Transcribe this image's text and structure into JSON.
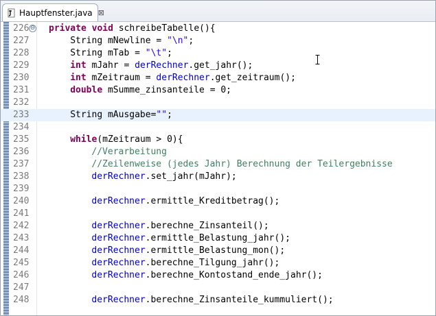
{
  "tab": {
    "title": "Hauptfenster.java",
    "close_glyph": "⊠",
    "icon": "java-file-icon"
  },
  "editor": {
    "current_line_index": 7,
    "lines": [
      {
        "num": "226",
        "fold": "⊖",
        "tokens": [
          {
            "t": "kw",
            "v": "private"
          },
          {
            "t": "p",
            "v": " "
          },
          {
            "t": "kw",
            "v": "void"
          },
          {
            "t": "p",
            "v": " schreibeTabelle(){"
          }
        ]
      },
      {
        "num": "227",
        "tokens": [
          {
            "t": "p",
            "v": "String mNewline = "
          },
          {
            "t": "str",
            "v": "\"\\n\""
          },
          {
            "t": "p",
            "v": ";"
          }
        ],
        "indent": 4
      },
      {
        "num": "228",
        "tokens": [
          {
            "t": "p",
            "v": "String mTab = "
          },
          {
            "t": "str",
            "v": "\"\\t\""
          },
          {
            "t": "p",
            "v": ";"
          }
        ],
        "indent": 4
      },
      {
        "num": "229",
        "tokens": [
          {
            "t": "kw",
            "v": "int"
          },
          {
            "t": "p",
            "v": " mJahr = "
          },
          {
            "t": "fld",
            "v": "derRechner"
          },
          {
            "t": "p",
            "v": ".get_jahr();"
          }
        ],
        "indent": 4
      },
      {
        "num": "230",
        "tokens": [
          {
            "t": "kw",
            "v": "int"
          },
          {
            "t": "p",
            "v": " mZeitraum = "
          },
          {
            "t": "fld",
            "v": "derRechner"
          },
          {
            "t": "p",
            "v": ".get_zeitraum();"
          }
        ],
        "indent": 4
      },
      {
        "num": "231",
        "tokens": [
          {
            "t": "kw",
            "v": "double"
          },
          {
            "t": "p",
            "v": " mSumme_zinsanteile = 0;"
          }
        ],
        "indent": 4
      },
      {
        "num": "232",
        "tokens": [],
        "indent": 0
      },
      {
        "num": "233",
        "tokens": [
          {
            "t": "p",
            "v": "String mAusgabe="
          },
          {
            "t": "str",
            "v": "\"\""
          },
          {
            "t": "p",
            "v": ";"
          }
        ],
        "indent": 4
      },
      {
        "num": "234",
        "tokens": [],
        "indent": 0
      },
      {
        "num": "235",
        "tokens": [
          {
            "t": "kw",
            "v": "while"
          },
          {
            "t": "p",
            "v": "(mZeitraum > 0){"
          }
        ],
        "indent": 4
      },
      {
        "num": "236",
        "tokens": [
          {
            "t": "cmt",
            "v": "//Verarbeitung"
          }
        ],
        "indent": 8
      },
      {
        "num": "237",
        "tokens": [
          {
            "t": "cmt",
            "v": "//Zeilenweise (jedes Jahr) Berechnung der Teilergebnisse"
          }
        ],
        "indent": 8
      },
      {
        "num": "238",
        "tokens": [
          {
            "t": "fld",
            "v": "derRechner"
          },
          {
            "t": "p",
            "v": ".set_jahr(mJahr);"
          }
        ],
        "indent": 8
      },
      {
        "num": "239",
        "tokens": [],
        "indent": 0
      },
      {
        "num": "240",
        "tokens": [
          {
            "t": "fld",
            "v": "derRechner"
          },
          {
            "t": "p",
            "v": ".ermittle_Kreditbetrag();"
          }
        ],
        "indent": 8
      },
      {
        "num": "241",
        "tokens": [],
        "indent": 0
      },
      {
        "num": "242",
        "tokens": [
          {
            "t": "fld",
            "v": "derRechner"
          },
          {
            "t": "p",
            "v": ".berechne_Zinsanteil();"
          }
        ],
        "indent": 8
      },
      {
        "num": "243",
        "tokens": [
          {
            "t": "fld",
            "v": "derRechner"
          },
          {
            "t": "p",
            "v": ".ermittle_Belastung_jahr();"
          }
        ],
        "indent": 8
      },
      {
        "num": "244",
        "tokens": [
          {
            "t": "fld",
            "v": "derRechner"
          },
          {
            "t": "p",
            "v": ".ermittle_Belastung_mon();"
          }
        ],
        "indent": 8
      },
      {
        "num": "245",
        "tokens": [
          {
            "t": "fld",
            "v": "derRechner"
          },
          {
            "t": "p",
            "v": ".berechne_Tilgung_jahr();"
          }
        ],
        "indent": 8
      },
      {
        "num": "246",
        "tokens": [
          {
            "t": "fld",
            "v": "derRechner"
          },
          {
            "t": "p",
            "v": ".berechne_Kontostand_ende_jahr();"
          }
        ],
        "indent": 8
      },
      {
        "num": "247",
        "tokens": [],
        "indent": 0
      },
      {
        "num": "248",
        "tokens": [
          {
            "t": "fld",
            "v": "derRechner"
          },
          {
            "t": "p",
            "v": ".berechne_Zinsanteile_kummuliert();"
          }
        ],
        "indent": 8
      }
    ]
  },
  "colors": {
    "keyword": "#7f0055",
    "string": "#2a00ff",
    "comment": "#3f7f5f",
    "field": "#0000c0",
    "current_line": "#e8f2fe"
  }
}
